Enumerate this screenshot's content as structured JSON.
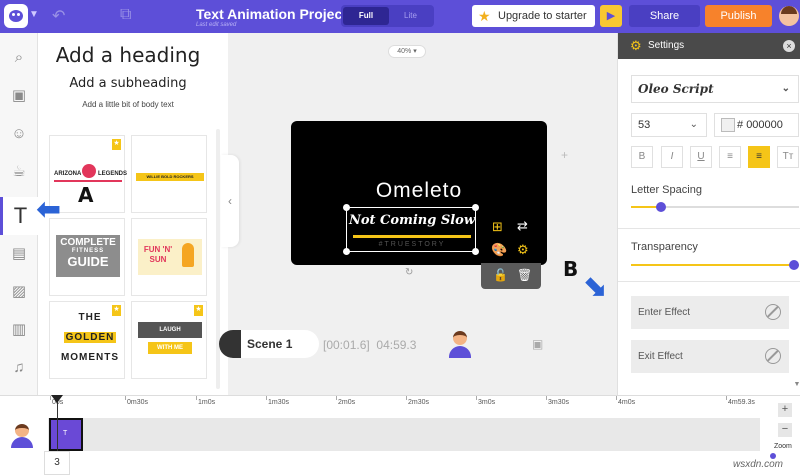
{
  "header": {
    "project_title": "Text Animation Project",
    "last_edit": "Last edit saved",
    "mode_full": "Full",
    "mode_lite": "Lite",
    "upgrade_label": "Upgrade to starter",
    "share_label": "Share",
    "publish_label": "Publish",
    "accent": "#5d4fd8",
    "publish_color": "#f7822b"
  },
  "rail": {
    "items": [
      "search-icon",
      "media-icon",
      "character-icon",
      "properties-icon",
      "text-icon",
      "background-icon",
      "image-icon",
      "video-icon",
      "music-icon"
    ]
  },
  "text_panel": {
    "heading": "Add a heading",
    "subheading": "Add a subheading",
    "body": "Add a little bit of body text",
    "tiles": [
      {
        "arizona": "ARIZONA",
        "legends": "LEGENDS"
      },
      {
        "willie": "WILLIE BOLD ROCKERS"
      },
      {
        "complete": "COMPLETE",
        "fitness": "FITNESS",
        "guide": "GUIDE"
      },
      {
        "fun": "FUN 'N' SUN"
      },
      {
        "golden_1": "THE",
        "golden_2": "GOLDEN",
        "golden_3": "MOMENTS"
      },
      {
        "laugh": "LAUGH",
        "with_me": "WITH ME"
      }
    ]
  },
  "annotations": {
    "a": "A",
    "b": "B"
  },
  "canvas": {
    "zoom": "40%",
    "title": "Omeleto",
    "tagline": "Not Coming Slow",
    "subline": "#TRUESTORY"
  },
  "scene": {
    "label": "Scene 1",
    "start": "[00:01.6]",
    "duration": "04:59.3"
  },
  "settings": {
    "title": "Settings",
    "font_name": "Oleo Script",
    "font_size": "53",
    "color_hash": "#",
    "color_value": "000000",
    "letter_spacing_label": "Letter Spacing",
    "letter_spacing_fraction": 0.18,
    "transparency_label": "Transparency",
    "transparency_fraction": 1.0,
    "enter_effect": "Enter Effect",
    "exit_effect": "Exit Effect",
    "format_buttons": [
      "B",
      "I",
      "U",
      "≡",
      "≡",
      "Tт"
    ]
  },
  "timeline": {
    "ticks": [
      "00s",
      "0m30s",
      "1m0s",
      "1m30s",
      "2m0s",
      "2m30s",
      "3m0s",
      "3m30s",
      "4m0s",
      "4m59.3s"
    ],
    "track_number": "3",
    "zoom_label": "Zoom",
    "clip_label": "T"
  },
  "watermark": "wsxdn.com"
}
